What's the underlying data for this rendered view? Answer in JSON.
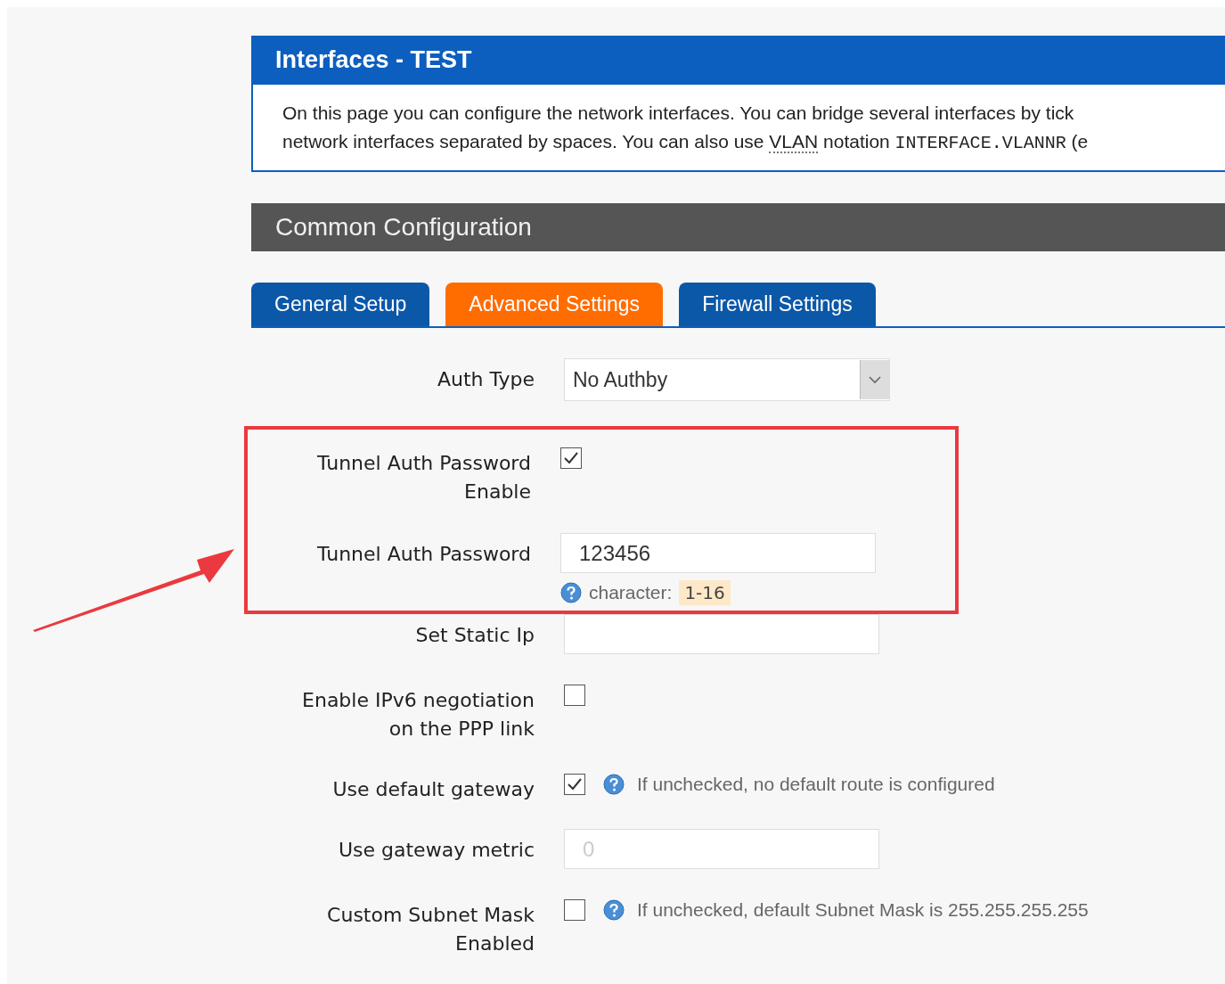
{
  "panel": {
    "title": "Interfaces - TEST",
    "description": [
      [
        {
          "kind": "text",
          "text": "On this page you can configure the network interfaces. You can bridge several interfaces by tick"
        }
      ],
      [
        {
          "kind": "text",
          "text": "network interfaces separated by spaces. You can also use "
        },
        {
          "kind": "abbr",
          "text": "VLAN"
        },
        {
          "kind": "text",
          "text": " notation "
        },
        {
          "kind": "code",
          "text": "INTERFACE.VLANNR"
        },
        {
          "kind": "text",
          "text": " (e"
        }
      ]
    ]
  },
  "section": {
    "title": "Common Configuration"
  },
  "tabs": [
    {
      "label": "General Setup",
      "selected": false
    },
    {
      "label": "Advanced Settings",
      "selected": true
    },
    {
      "label": "Firewall Settings",
      "selected": false
    }
  ],
  "fields": [
    {
      "kind": "select",
      "label": [
        "Auth Type"
      ],
      "value": "No Authby",
      "highlighted": false
    },
    {
      "kind": "checkbox",
      "label": [
        "Tunnel Auth Password",
        "Enable"
      ],
      "checked": true,
      "highlighted": true
    },
    {
      "kind": "text",
      "label": [
        "Tunnel Auth Password"
      ],
      "value": "123456",
      "hint": {
        "text": "character:",
        "badge": "1-16"
      },
      "highlighted": true
    },
    {
      "kind": "text",
      "label": [
        "Set Static Ip"
      ],
      "highlighted": false
    },
    {
      "kind": "checkbox",
      "label": [
        "Enable IPv6 negotiation",
        "on the PPP link"
      ],
      "checked": false,
      "highlighted": false
    },
    {
      "kind": "checkbox",
      "label": [
        "Use default gateway"
      ],
      "checked": true,
      "hint": {
        "text": "If unchecked, no default route is configured"
      },
      "highlighted": false
    },
    {
      "kind": "text",
      "label": [
        "Use gateway metric"
      ],
      "placeholder": "0",
      "highlighted": false
    },
    {
      "kind": "checkbox",
      "label": [
        "Custom Subnet Mask",
        "Enabled"
      ],
      "checked": false,
      "hint": {
        "text": "If unchecked, default Subnet Mask is 255.255.255.255"
      },
      "highlighted": false
    }
  ]
}
